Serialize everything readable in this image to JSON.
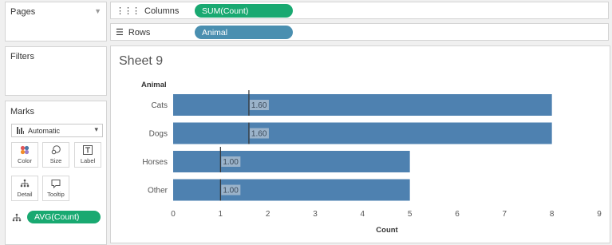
{
  "pages": {
    "title": "Pages"
  },
  "filters": {
    "title": "Filters"
  },
  "marks": {
    "title": "Marks",
    "mark_type": "Automatic",
    "buttons": {
      "color": "Color",
      "size": "Size",
      "label": "Label",
      "detail": "Detail",
      "tooltip": "Tooltip"
    },
    "field_pill": "AVG(Count)"
  },
  "shelves": {
    "columns_label": "Columns",
    "columns_pill": "SUM(Count)",
    "rows_label": "Rows",
    "rows_pill": "Animal"
  },
  "sheet": {
    "title": "Sheet 9"
  },
  "colors": {
    "bar": "#4e81b0",
    "pill_green": "#19a971",
    "pill_blue": "#4a8fb0"
  },
  "chart_data": {
    "type": "bar",
    "orientation": "horizontal",
    "row_header": "Animal",
    "categories": [
      "Cats",
      "Dogs",
      "Horses",
      "Other"
    ],
    "values": [
      8,
      8,
      5,
      5
    ],
    "reference_values": [
      1.6,
      1.6,
      1.0,
      1.0
    ],
    "reference_labels": [
      "1.60",
      "1.60",
      "1.00",
      "1.00"
    ],
    "xlabel": "Count",
    "xlim": [
      0,
      9
    ],
    "xticks": [
      "0",
      "1",
      "2",
      "3",
      "4",
      "5",
      "6",
      "7",
      "8",
      "9"
    ],
    "grid": false
  }
}
